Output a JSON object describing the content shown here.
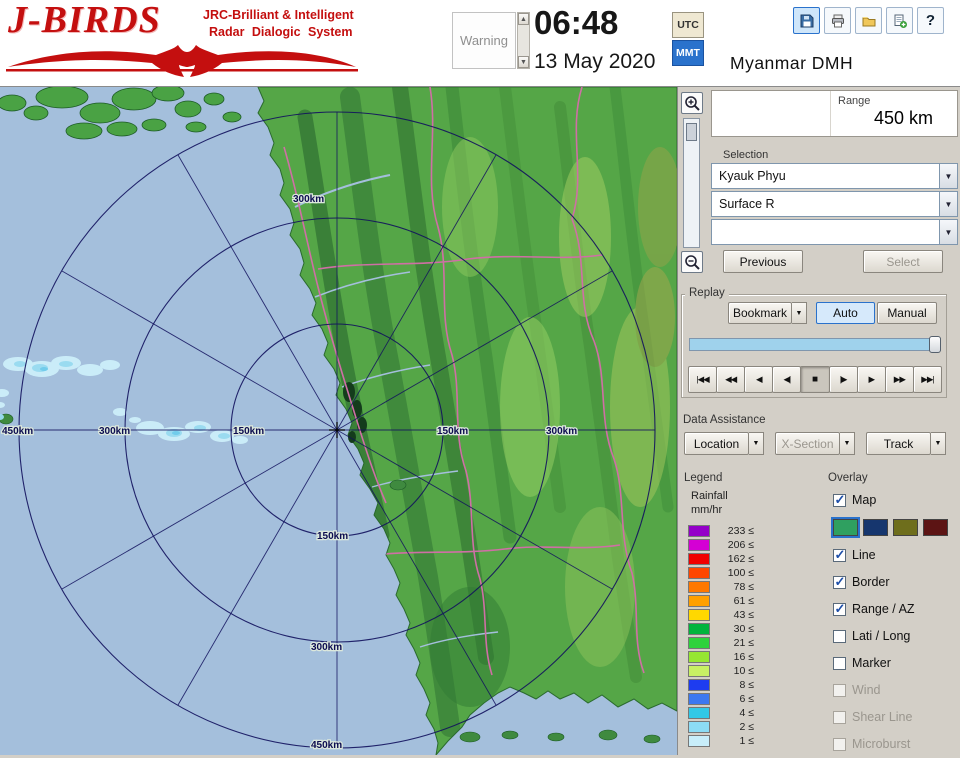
{
  "header": {
    "logo_title": "J-BIRDS",
    "logo_sub1": "JRC-Brilliant & Intelligent",
    "logo_sub2": "Radar Dialogic System",
    "logo_red": "#c40f0f",
    "warning_label": "Warning",
    "time": "06:48",
    "date": "13 May 2020",
    "utc": "UTC",
    "mmt": "MMT",
    "mmt_active_color": "#2a72cc",
    "station": "Myanmar DMH",
    "help_glyph": "?"
  },
  "range_box": {
    "label": "Range",
    "value": "450 km"
  },
  "selection": {
    "label": "Selection",
    "site": "Kyauk Phyu",
    "product": "Surface R",
    "extra": "",
    "previous": "Previous",
    "select": "Select"
  },
  "replay": {
    "label": "Replay",
    "bookmark": "Bookmark",
    "auto": "Auto",
    "manual": "Manual",
    "playback": [
      "|◀◀",
      "◀◀",
      "◀",
      "◀|",
      "■",
      "|▶",
      "▶",
      "▶▶",
      "▶▶|"
    ]
  },
  "data_assistance": {
    "label": "Data Assistance",
    "location": "Location",
    "xsection": "X-Section",
    "track": "Track"
  },
  "legend": {
    "label": "Legend",
    "unit1": "Rainfall",
    "unit2": "mm/hr",
    "entries": [
      {
        "value": "233 ≤",
        "color": "#9400c8"
      },
      {
        "value": "206 ≤",
        "color": "#d400d4"
      },
      {
        "value": "162 ≤",
        "color": "#f00000"
      },
      {
        "value": "100 ≤",
        "color": "#ff4600"
      },
      {
        "value": "78 ≤",
        "color": "#ff7800"
      },
      {
        "value": "61 ≤",
        "color": "#ffa000"
      },
      {
        "value": "43 ≤",
        "color": "#ffd800"
      },
      {
        "value": "30 ≤",
        "color": "#00b43c"
      },
      {
        "value": "21 ≤",
        "color": "#2ed23c"
      },
      {
        "value": "16 ≤",
        "color": "#96e632"
      },
      {
        "value": "10 ≤",
        "color": "#c8f064"
      },
      {
        "value": "8 ≤",
        "color": "#1e3cf0"
      },
      {
        "value": "6 ≤",
        "color": "#3c78f0"
      },
      {
        "value": "4 ≤",
        "color": "#32c8e6"
      },
      {
        "value": "2 ≤",
        "color": "#8cdcf5"
      },
      {
        "value": "1 ≤",
        "color": "#c8eefa"
      }
    ]
  },
  "overlay": {
    "label": "Overlay",
    "swatches": [
      "#2fa060",
      "#16366e",
      "#6e6e1c",
      "#5c1414"
    ],
    "items": [
      {
        "label": "Map",
        "checked": true,
        "enabled": true
      },
      {
        "label": "Line",
        "checked": true,
        "enabled": true
      },
      {
        "label": "Border",
        "checked": true,
        "enabled": true
      },
      {
        "label": "Range / AZ",
        "checked": true,
        "enabled": true
      },
      {
        "label": "Lati / Long",
        "checked": false,
        "enabled": true
      },
      {
        "label": "Marker",
        "checked": false,
        "enabled": true
      },
      {
        "label": "Wind",
        "checked": false,
        "enabled": false
      },
      {
        "label": "Shear Line",
        "checked": false,
        "enabled": false
      },
      {
        "label": "Microburst",
        "checked": false,
        "enabled": false
      }
    ]
  },
  "map": {
    "ring_labels": [
      "450km",
      "300km",
      "150km",
      "150km",
      "300km",
      "300km",
      "150km",
      "300km",
      "450km"
    ]
  }
}
